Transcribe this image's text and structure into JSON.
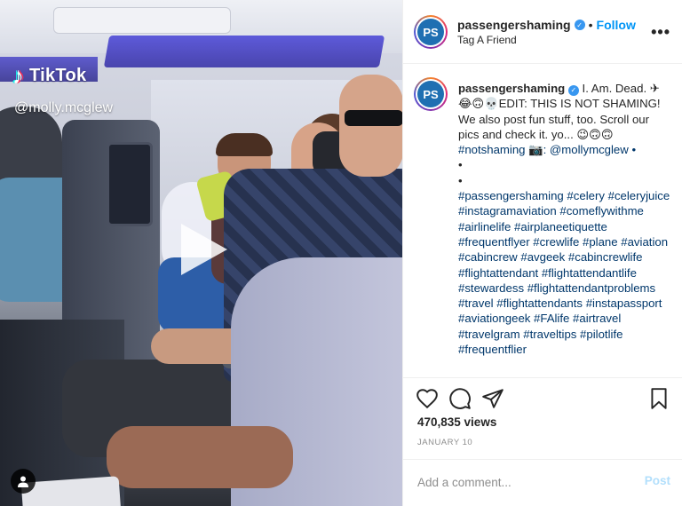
{
  "video": {
    "watermark_app": "TikTok",
    "watermark_user": "@molly.mcglew",
    "play_icon": "play-icon",
    "user_tag_icon": "person-icon"
  },
  "header": {
    "username": "passengershaming",
    "separator": "•",
    "follow_label": "Follow",
    "subtitle": "Tag A Friend",
    "more_icon": "ellipsis-icon",
    "more_label": "•••",
    "avatar_text": "PS"
  },
  "caption": {
    "username": "passengershaming",
    "line1": " I. Am. Dead. ✈ 😂🙃💀EDIT: THIS IS NOT SHAMING! We also post fun stuff, too. Scroll our pics and check it. yo... 😉🙃🙃 ",
    "line2": "#notshaming 📷: @mollymcglew •",
    "dot1": "•",
    "dot2": "•",
    "hashtags": "#passengershaming #celery #celeryjuice #instagramaviation #comeflywithme #airlinelife #airplaneetiquette #frequentflyer #crewlife #plane #aviation #cabincrew #avgeek #cabincrewlife #flightattendant #flightattendantlife #stewardess #flightattendantproblems #travel #flightattendants #instapassport #aviationgeek #FAlife #airtravel #travelgram #traveltips #pilotlife #frequentflier"
  },
  "actions": {
    "like_icon": "heart-icon",
    "comment_icon": "comment-icon",
    "share_icon": "paper-plane-icon",
    "save_icon": "bookmark-icon",
    "views": "470,835 views",
    "date": "JANUARY 10"
  },
  "comment": {
    "placeholder": "Add a comment...",
    "post_label": "Post"
  },
  "colors": {
    "link": "#00376b",
    "follow": "#0095f6",
    "post_disabled": "#b2dffc",
    "verified": "#3897f0"
  }
}
